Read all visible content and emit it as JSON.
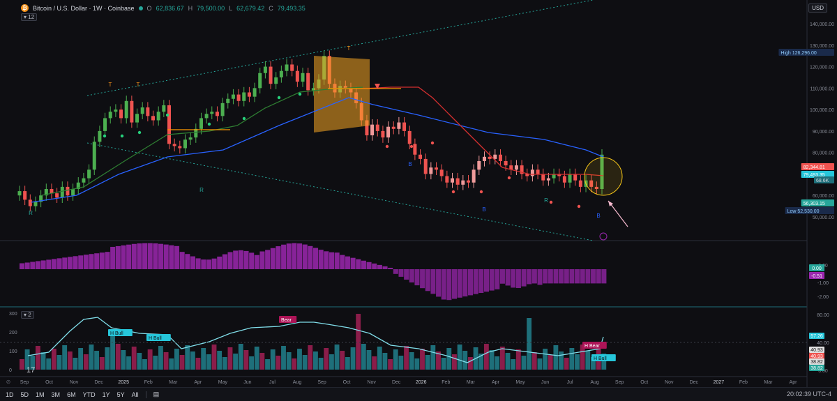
{
  "legend": {
    "symbol": "Bitcoin / U.S. Dollar · 1W · Coinbase",
    "open_label": "O",
    "open": "62,836.67",
    "high_label": "H",
    "high": "79,500.00",
    "low_label": "L",
    "low": "62,679.42",
    "close_label": "C",
    "close": "79,493.35",
    "indicator_count": "12"
  },
  "currency": "USD",
  "price_axis": {
    "ticks": [
      "140,000.00",
      "130,000.00",
      "120,000.00",
      "110,000.00",
      "100,000.00",
      "90,000.00",
      "80,000.00",
      "70,000.00",
      "60,000.00",
      "50,000.00"
    ],
    "badges": [
      {
        "text": "High",
        "value": "126,296.00",
        "kind": "high"
      },
      {
        "text": "",
        "value": "82,344.81",
        "kind": "red"
      },
      {
        "text": "",
        "value": "79,493.35",
        "kind": "cyan"
      },
      {
        "text": "",
        "value": "68.6K",
        "kind": "cyan2"
      },
      {
        "text": "",
        "value": "56,303.15",
        "kind": "green"
      },
      {
        "text": "Low",
        "value": "52,530.00",
        "kind": "low"
      }
    ]
  },
  "osc_axis": {
    "ticks": [
      "0.00",
      "-1.00",
      "-2.00"
    ],
    "badges": [
      {
        "value": "0.00",
        "kind": "green"
      },
      {
        "value": "-0.51",
        "kind": "purple"
      }
    ]
  },
  "vol_axis": {
    "ticks": [
      "80.00",
      "40.00",
      "0.00"
    ],
    "left_ticks": [
      "300",
      "200",
      "100",
      "0"
    ],
    "badges": [
      {
        "value": "57.26",
        "kind": "cyan"
      },
      {
        "value": "40.93",
        "kind": "white"
      },
      {
        "value": "40.93",
        "kind": "red"
      },
      {
        "value": "38.82",
        "kind": "white"
      },
      {
        "value": "38.82",
        "kind": "teal"
      }
    ],
    "pane_badge": "2"
  },
  "time_axis": [
    "Sep",
    "Oct",
    "Nov",
    "Dec",
    "2025",
    "Feb",
    "Mar",
    "Apr",
    "May",
    "Jun",
    "Jul",
    "Aug",
    "Sep",
    "Oct",
    "Nov",
    "Dec",
    "2026",
    "Feb",
    "Mar",
    "Apr",
    "May",
    "Jun",
    "Jul",
    "Aug",
    "Sep",
    "Oct",
    "Nov",
    "Dec",
    "2027",
    "Feb",
    "Mar",
    "Apr"
  ],
  "markers": {
    "T": "T",
    "R": "R",
    "B": "B",
    "h_bull": "H Bull",
    "h_bear": "H Bear",
    "bear": "Bear"
  },
  "toolbar": {
    "timeframes": [
      "1D",
      "5D",
      "1M",
      "3M",
      "6M",
      "YTD",
      "1Y",
      "5Y",
      "All"
    ],
    "clock": "20:02:39 UTC-4"
  },
  "colors": {
    "up": "#4caf50",
    "down": "#ef5350",
    "bg": "#0e0e12",
    "ema_green": "#2e7d32",
    "ema_blue": "#2962ff",
    "ema_red": "#d32f2f",
    "osc": "#9c27b0",
    "vol_up": "#1e6f7a",
    "vol_down": "#8b1d4a",
    "line": "#80deea"
  }
}
